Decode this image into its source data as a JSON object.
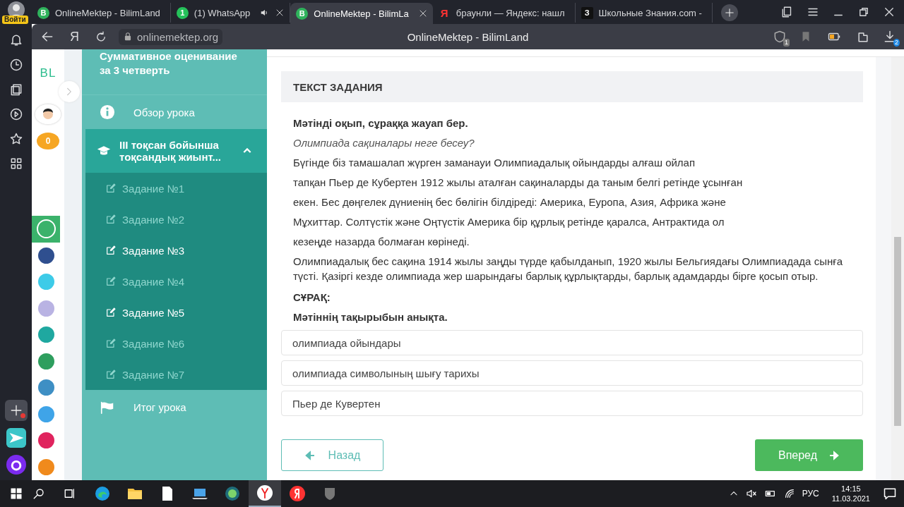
{
  "browser": {
    "profile_label": "Войти",
    "tabs": [
      {
        "kind": "bilim",
        "favicon_text": "B",
        "title": "OnlineMektep - BilimLand",
        "selected": false,
        "audio": false,
        "closable": false
      },
      {
        "kind": "whatsapp",
        "favicon_text": "1",
        "title": "(1) WhatsApp",
        "selected": false,
        "audio": true,
        "closable": true
      },
      {
        "kind": "bilim",
        "favicon_text": "B",
        "title": "OnlineMektep - BilimLa",
        "selected": true,
        "audio": false,
        "closable": true
      },
      {
        "kind": "yandex",
        "favicon_text": "Я",
        "title": "браунли — Яндекс: нашл",
        "selected": false,
        "audio": false,
        "closable": false
      },
      {
        "kind": "znania",
        "favicon_text": "З",
        "title": "Школьные Знания.com -",
        "selected": false,
        "audio": false,
        "closable": false
      }
    ],
    "home_button": "Я",
    "address": "onlinemektep.org",
    "page_title": "OnlineMektep - BilimLand",
    "shield_badge": "1",
    "download_badge": "2"
  },
  "site": {
    "logo": "BL",
    "coins": "0",
    "apps": [
      {
        "color": "#3bb26b",
        "selected": true
      },
      {
        "color": "#2f4f8f",
        "selected": false
      },
      {
        "color": "#3dcbe8",
        "selected": false
      },
      {
        "color": "#b9b3e3",
        "selected": false
      },
      {
        "color": "#1fa8a0",
        "selected": false
      },
      {
        "color": "#2e9e5e",
        "selected": false
      },
      {
        "color": "#3e8fc4",
        "selected": false
      },
      {
        "color": "#3fa4e8",
        "selected": false
      },
      {
        "color": "#e0245e",
        "selected": false
      },
      {
        "color": "#f08a1c",
        "selected": false
      }
    ]
  },
  "lesson_nav": {
    "title": "Суммативное оценивание за 3 четверть",
    "overview": "Обзор урока",
    "section": {
      "title": "III тоқсан бойынша тоқсандық жиынт...",
      "expanded": true,
      "tasks": [
        {
          "label": "Задание №1",
          "visited": false
        },
        {
          "label": "Задание №2",
          "visited": false
        },
        {
          "label": "Задание №3",
          "visited": true
        },
        {
          "label": "Задание №4",
          "visited": false
        },
        {
          "label": "Задание №5",
          "visited": true
        },
        {
          "label": "Задание №6",
          "visited": false
        },
        {
          "label": "Задание №7",
          "visited": false
        }
      ]
    },
    "summary": "Итог урока"
  },
  "task": {
    "header": "ТЕКСТ ЗАДАНИЯ",
    "instruction": "Мәтінді оқып, сұраққа жауап бер.",
    "subtitle": "Олимпиада сақиналары неге бесеу?",
    "lines": [
      "Бүгінде біз тамашалап жүрген заманауи Олимпиадалық ойындарды алғаш ойлап",
      "тапқан Пьер де Кубертен 1912 жылы аталған сақиналарды да таным белгі ретінде ұсынған",
      "екен. Бес дөңгелек дүниенің бес бөлігін білдіреді: Америка, Еуропа, Азия, Африка және",
      "Мұхиттар. Солтүстік және Оңтүстік Америка бір құрлық ретінде қаралса, Антрактида ол",
      "кезеңде назарда болмаған көрінеді."
    ],
    "paragraph": "Олимпиадалық бес сақина 1914 жылы заңды түрде қабылданып, 1920 жылы Бельгиядағы Олимпиадада сынға түсті. Қазіргі кезде олимпиада жер шарындағы барлық құрлықтарды, барлық адамдарды бірге қосып отыр.",
    "question_label": "СҰРАҚ:",
    "question": "Мәтіннің тақырыбын анықта.",
    "options": [
      {
        "text": "олимпиада ойындары",
        "selected": false
      },
      {
        "text": "олимпиада символының шығу тарихы",
        "selected": false
      },
      {
        "text": "Пьер де Кувертен",
        "selected": false
      }
    ]
  },
  "nav_buttons": {
    "back": "Назад",
    "next": "Вперед"
  },
  "taskbar": {
    "apps": [
      {
        "kind": "edge",
        "selected": false
      },
      {
        "kind": "folder",
        "selected": false
      },
      {
        "kind": "file",
        "selected": false
      },
      {
        "kind": "laptop",
        "selected": false
      },
      {
        "kind": "globe",
        "selected": false
      },
      {
        "kind": "yandex-browser",
        "selected": true
      },
      {
        "kind": "yandex",
        "selected": false
      },
      {
        "kind": "tanks",
        "selected": false
      }
    ],
    "language": "РУС",
    "time": "14:15",
    "date": "11.03.2021"
  }
}
